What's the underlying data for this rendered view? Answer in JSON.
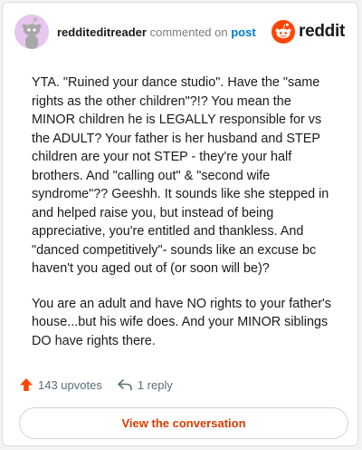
{
  "header": {
    "username": "redditeditreader",
    "action": "commented on",
    "target": "post",
    "brand": "reddit"
  },
  "comment": {
    "paragraphs": [
      "YTA. \"Ruined your dance studio\". Have the \"same rights as the other children\"?!? You mean the MINOR children he is LEGALLY responsible for vs the ADULT? Your father is her husband and STEP children are your not STEP - they're your half brothers. And \"calling out\" & \"second wife syndrome\"?? Geeshh. It sounds like she stepped in and helped raise you, but instead of being appreciative, you're entitled and thankless. And \"danced competitively\"- sounds like an excuse bc haven't you aged out of (or soon will be)?",
      "You are an adult and have NO rights to your father's house...but his wife does. And your MINOR siblings DO have rights there."
    ]
  },
  "stats": {
    "upvotes": "143 upvotes",
    "replies": "1 reply"
  },
  "cta": {
    "label": "View the conversation"
  },
  "colors": {
    "accent": "#ff4500",
    "link": "#0079d3",
    "cta_text": "#d93a00"
  },
  "icons": [
    "avatar",
    "reddit-logo-icon",
    "upvote-arrow-icon",
    "reply-arrow-icon"
  ]
}
